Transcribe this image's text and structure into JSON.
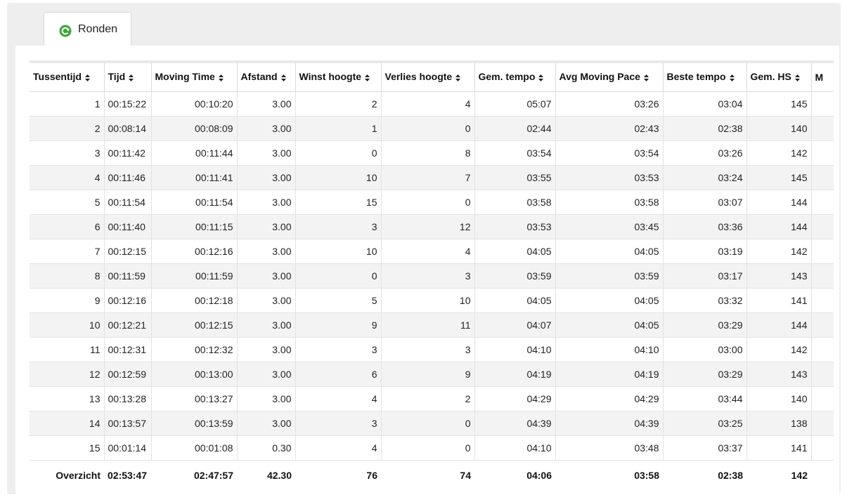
{
  "tab": {
    "label": "Ronden",
    "icon": "refresh-icon",
    "icon_color": "#3aa935"
  },
  "table": {
    "columns": [
      "Tussentijd",
      "Tijd",
      "Moving Time",
      "Afstand",
      "Winst hoogte",
      "Verlies hoogte",
      "Gem. tempo",
      "Avg Moving Pace",
      "Beste tempo",
      "Gem. HS",
      "M"
    ],
    "rows": [
      [
        "1",
        "00:15:22",
        "00:10:20",
        "3.00",
        "2",
        "4",
        "05:07",
        "03:26",
        "03:04",
        "145",
        ""
      ],
      [
        "2",
        "00:08:14",
        "00:08:09",
        "3.00",
        "1",
        "0",
        "02:44",
        "02:43",
        "02:38",
        "140",
        ""
      ],
      [
        "3",
        "00:11:42",
        "00:11:44",
        "3.00",
        "0",
        "8",
        "03:54",
        "03:54",
        "03:26",
        "142",
        ""
      ],
      [
        "4",
        "00:11:46",
        "00:11:41",
        "3.00",
        "10",
        "7",
        "03:55",
        "03:53",
        "03:24",
        "145",
        ""
      ],
      [
        "5",
        "00:11:54",
        "00:11:54",
        "3.00",
        "15",
        "0",
        "03:58",
        "03:58",
        "03:07",
        "144",
        ""
      ],
      [
        "6",
        "00:11:40",
        "00:11:15",
        "3.00",
        "3",
        "12",
        "03:53",
        "03:45",
        "03:36",
        "144",
        ""
      ],
      [
        "7",
        "00:12:15",
        "00:12:16",
        "3.00",
        "10",
        "4",
        "04:05",
        "04:05",
        "03:19",
        "142",
        ""
      ],
      [
        "8",
        "00:11:59",
        "00:11:59",
        "3.00",
        "0",
        "3",
        "03:59",
        "03:59",
        "03:17",
        "143",
        ""
      ],
      [
        "9",
        "00:12:16",
        "00:12:18",
        "3.00",
        "5",
        "10",
        "04:05",
        "04:05",
        "03:32",
        "141",
        ""
      ],
      [
        "10",
        "00:12:21",
        "00:12:15",
        "3.00",
        "9",
        "11",
        "04:07",
        "04:05",
        "03:29",
        "144",
        ""
      ],
      [
        "11",
        "00:12:31",
        "00:12:32",
        "3.00",
        "3",
        "3",
        "04:10",
        "04:10",
        "03:00",
        "142",
        ""
      ],
      [
        "12",
        "00:12:59",
        "00:13:00",
        "3.00",
        "6",
        "9",
        "04:19",
        "04:19",
        "03:29",
        "143",
        ""
      ],
      [
        "13",
        "00:13:28",
        "00:13:27",
        "3.00",
        "4",
        "2",
        "04:29",
        "04:29",
        "03:44",
        "140",
        ""
      ],
      [
        "14",
        "00:13:57",
        "00:13:59",
        "3.00",
        "3",
        "0",
        "04:39",
        "04:39",
        "03:25",
        "138",
        ""
      ],
      [
        "15",
        "00:01:14",
        "00:01:08",
        "0.30",
        "4",
        "0",
        "04:10",
        "03:48",
        "03:37",
        "141",
        ""
      ]
    ],
    "summary": [
      "Overzicht",
      "02:53:47",
      "02:47:57",
      "42.30",
      "76",
      "74",
      "04:06",
      "03:58",
      "02:38",
      "142",
      ""
    ]
  }
}
